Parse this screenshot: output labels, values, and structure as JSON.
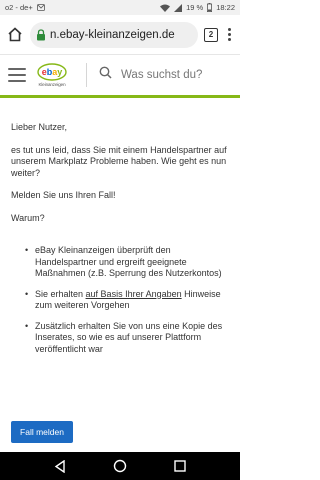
{
  "status_bar": {
    "carrier": "o2 - de+",
    "battery": "19 %",
    "time": "18:22"
  },
  "browser": {
    "url": "n.ebay-kleinanzeigen.de",
    "tab_count": "2"
  },
  "site": {
    "logo_text": "ebay",
    "logo_sub": "Kleinanzeigen",
    "search_placeholder": "Was suchst du?"
  },
  "content": {
    "greeting": "Lieber Nutzer,",
    "intro": "es tut uns leid, dass Sie mit einem Handelspartner auf unserem Markplatz Probleme haben. Wie geht es nun weiter?",
    "report": "Melden Sie uns Ihren Fall!",
    "why": "Warum?",
    "reasons": [
      {
        "text": "eBay Kleinanzeigen überprüft den Handelspartner und ergreift geeignete Maßnahmen (z.B. Sperrung des Nutzerkontos)"
      },
      {
        "prefix": "Sie erhalten ",
        "link": "auf Basis Ihrer Angaben",
        "suffix": " Hinweise zum weiteren Vorgehen"
      },
      {
        "text": "Zusätzlich erhalten Sie von uns eine Kopie des Inserates, so wie es auf unserer Plattform veröffentlicht war"
      }
    ],
    "button_label": "Fall melden"
  },
  "colors": {
    "accent_green": "#86b817",
    "button_blue": "#1d6bc3"
  },
  "icons": [
    "home-icon",
    "lock-icon",
    "tabs-icon",
    "menu-icon",
    "hamburger-icon",
    "search-icon",
    "back-icon",
    "home-circle-icon",
    "recents-icon"
  ]
}
